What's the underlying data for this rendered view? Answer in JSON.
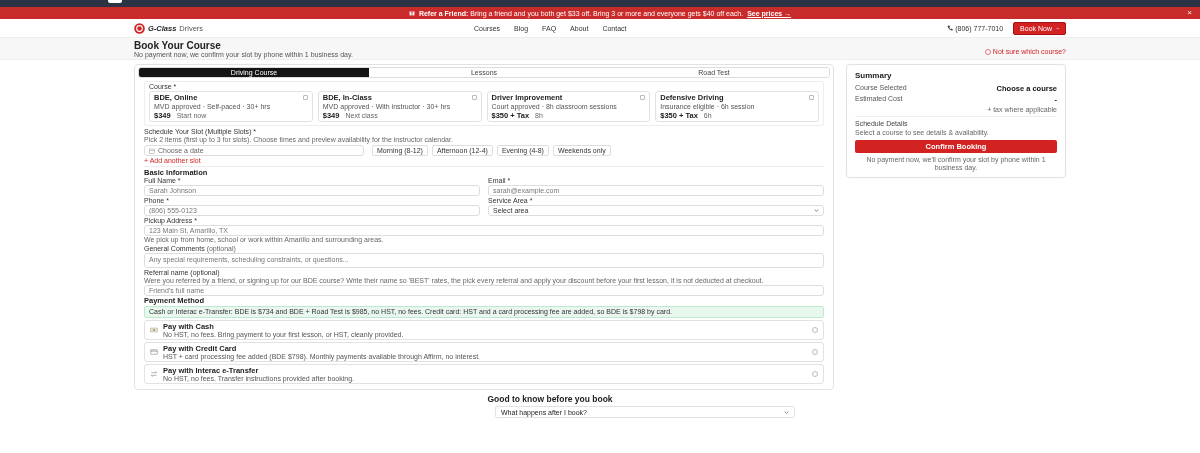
{
  "banner": {
    "text": "**Refer a Friend:** Bring a friend and you both get $33 off. Bring 3 or more and everyone gets $40 off each.",
    "link": "See prices →",
    "close": "×"
  },
  "header": {
    "logo_name": "G-Class",
    "logo_suffix": "Drivers",
    "nav": [
      "Courses",
      "Blog",
      "FAQ",
      "About",
      "Contact"
    ],
    "phone": "(806) 777-7010",
    "book_button": "Book Now"
  },
  "page": {
    "title": "Book Your Course",
    "subtitle": "No payment now, we confirm your slot by phone within 1 business day.",
    "help_link": "Not sure which course?"
  },
  "tabs": [
    {
      "label": "Driving Course",
      "selected": true
    },
    {
      "label": "Lessons",
      "selected": false
    },
    {
      "label": "Road Test",
      "selected": false
    }
  ],
  "course": {
    "label": "Course *",
    "options": [
      {
        "name": "BDE, Online",
        "desc": "MVD approved · Self-paced · 30+ hrs",
        "price": "$349",
        "note": "Start now",
        "selected": false
      },
      {
        "name": "BDE, In-Class",
        "desc": "MVD approved · With instructor · 30+ hrs",
        "price": "$349",
        "note": "Next class",
        "selected": false
      },
      {
        "name": "Driver Improvement",
        "desc": "Court approved · 8h classroom sessions",
        "price": "$350 + Tax",
        "note": "8h",
        "selected": false
      },
      {
        "name": "Defensive Driving",
        "desc": "Insurance eligible · 6h session",
        "price": "$350 + Tax",
        "note": "6h",
        "selected": false
      }
    ]
  },
  "schedule": {
    "label": "Schedule Your Slot (Multiple Slots) *",
    "hint": "Pick 2 items (first up to 3 for slots). Choose times and preview availability for the instructor calendar.",
    "date_placeholder": "Choose a date",
    "chips": [
      {
        "label": "Morning (8-12)",
        "selected": false
      },
      {
        "label": "Afternoon (12-4)",
        "selected": false
      },
      {
        "label": "Evening (4-8)",
        "selected": false
      },
      {
        "label": "Weekends only",
        "selected": false
      }
    ],
    "add_link": "+ Add another slot"
  },
  "basic": {
    "title": "Basic Information",
    "rows": [
      [
        {
          "kind": "input",
          "label": "Full Name *",
          "placeholder": "Sarah Johnson"
        },
        {
          "kind": "input",
          "label": "Email *",
          "placeholder": "sarah@example.com"
        }
      ],
      [
        {
          "kind": "input",
          "label": "Phone *",
          "placeholder": "(806) 555-0123"
        },
        {
          "kind": "select",
          "label": "Service Area *",
          "value": "Select area"
        }
      ],
      [
        {
          "kind": "input",
          "label": "Pickup Address *",
          "placeholder": "123 Main St, Amarillo, TX",
          "hint": "We pick up from home, school or work within Amarillo and surrounding areas."
        }
      ],
      [
        {
          "kind": "textarea",
          "label": "General Comments",
          "label_note": "(optional)",
          "placeholder": "Any special requirements, scheduling constraints, or questions..."
        }
      ],
      [
        {
          "kind": "input",
          "label": "Referral name (optional)",
          "hint_above": "Were you referred by a friend, or signing up for our BDE course? Write their name so 'BEST' rates, the pick every referral and apply your discount before your first lesson, it is not deducted at checkout.",
          "placeholder": "Friend's full name"
        }
      ]
    ]
  },
  "payment": {
    "title": "Payment Method",
    "note": "Cash or Interac e-Transfer: BDE is $734 and BDE + Road Test is $985, no HST, no fees. Credit card: HST and a card processing fee are added, so BDE is $798 by card.",
    "options": [
      {
        "kind": "cash",
        "name": "Pay with Cash",
        "desc": "No HST, no fees. Bring payment to your first lesson, or HST, cleanly provided.",
        "selected": false
      },
      {
        "kind": "card",
        "name": "Pay with Credit Card",
        "desc": "HST + card processing fee added (BDE $798). Monthly payments available through Affirm, no interest.",
        "selected": false
      },
      {
        "kind": "transfer",
        "name": "Pay with Interac e-Transfer",
        "desc": "No HST, no fees. Transfer instructions provided after booking.",
        "selected": false
      }
    ]
  },
  "summary": {
    "title": "Summary",
    "rows": [
      {
        "label": "Course Selected",
        "value": "Choose a course"
      },
      {
        "label": "Estimated Cost",
        "value": "-",
        "sub": "+ tax where applicable"
      }
    ],
    "schedule_title": "Schedule Details",
    "schedule_text": "Select a course to see details & availability.",
    "button": "Confirm Booking",
    "note": "No payment now, we'll confirm your slot by phone within 1 business day."
  },
  "faq": {
    "title": "Good to know before you book",
    "items": [
      {
        "question": "What happens after I book?",
        "expanded": false
      }
    ]
  }
}
